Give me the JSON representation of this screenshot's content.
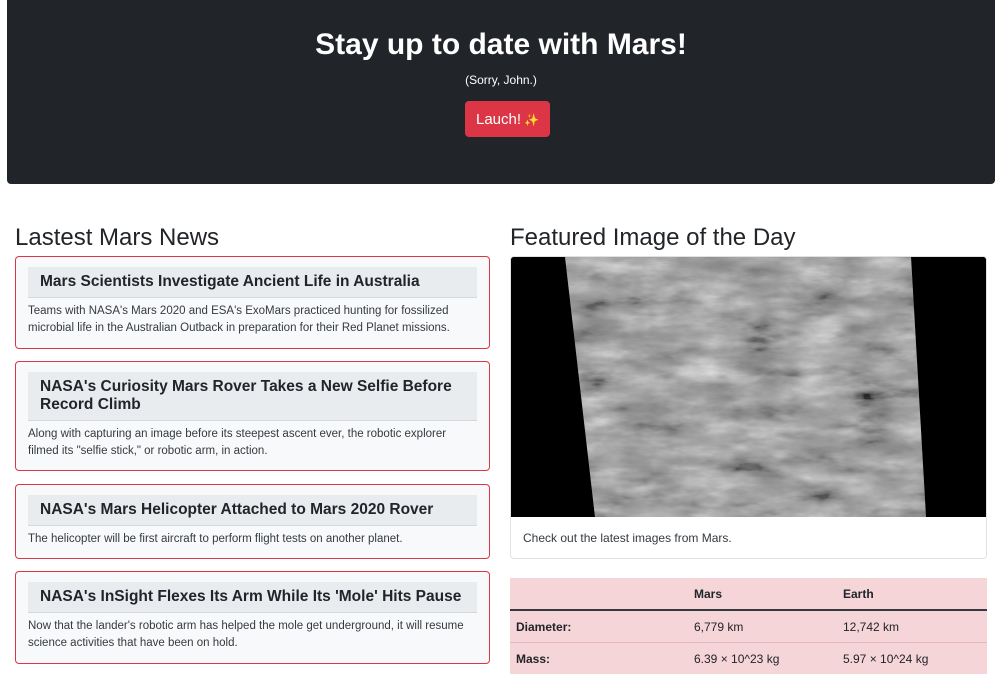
{
  "hero": {
    "title": "Stay up to date with Mars!",
    "subtitle": "(Sorry, John.)",
    "launch_label": "Lauch!",
    "launch_icon": "✨",
    "accent": "#dc3545",
    "background": "#212529"
  },
  "news": {
    "heading": "Lastest Mars News",
    "items": [
      {
        "title": "Mars Scientists Investigate Ancient Life in Australia",
        "body": "Teams with NASA's Mars 2020 and ESA's ExoMars practiced hunting for fossilized microbial life in the Australian Outback in preparation for their Red Planet missions."
      },
      {
        "title": "NASA's Curiosity Mars Rover Takes a New Selfie Before Record Climb",
        "body": "Along with capturing an image before its steepest ascent ever, the robotic explorer filmed its \"selfie stick,\" or robotic arm, in action."
      },
      {
        "title": "NASA's Mars Helicopter Attached to Mars 2020 Rover",
        "body": "The helicopter will be first aircraft to perform flight tests on another planet."
      },
      {
        "title": "NASA's InSight Flexes Its Arm While Its 'Mole' Hits Pause",
        "body": "Now that the lander's robotic arm has helped the mole get underground, it will resume science activities that have been on hold."
      }
    ]
  },
  "featured": {
    "heading": "Featured Image of the Day",
    "caption": "Check out the latest images from Mars."
  },
  "facts": {
    "headers": [
      "",
      "Mars",
      "Earth"
    ],
    "rows": [
      {
        "label": "Diameter:",
        "mars": "6,779 km",
        "earth": "12,742 km"
      },
      {
        "label": "Mass:",
        "mars": "6.39 × 10^23 kg",
        "earth": "5.97 × 10^24 kg"
      }
    ]
  }
}
